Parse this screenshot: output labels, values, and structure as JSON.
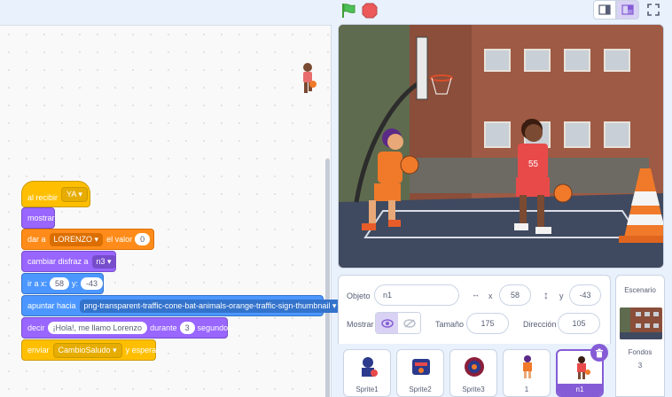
{
  "controls": {
    "green_flag": "green-flag-icon",
    "stop": "stop-icon"
  },
  "blocks": {
    "hat": {
      "prefix": "al recibir",
      "message": "YA"
    },
    "show": "mostrar",
    "set_var": {
      "prefix": "dar a",
      "variable": "LORENZO",
      "middle": "el valor",
      "value": "0"
    },
    "switch_costume": {
      "prefix": "cambiar disfraz a",
      "costume": "n3"
    },
    "goto": {
      "prefix": "ir a x:",
      "x": "58",
      "y_label": "y:",
      "y": "-43"
    },
    "point_towards": {
      "prefix": "apuntar hacia",
      "target": "png-transparent-traffic-cone-bat-animals-orange-traffic-sign-thumbnail"
    },
    "say_for": {
      "prefix": "decir",
      "message": "¡Hola!, me llamo Lorenzo",
      "middle": "durante",
      "secs": "3",
      "suffix": "segundos"
    },
    "broadcast_wait": {
      "prefix": "enviar",
      "message": "CambioSaludo",
      "suffix": "y esperar"
    }
  },
  "sprite_info": {
    "sprite_label": "Objeto",
    "sprite_name": "n1",
    "x_label": "x",
    "x": "58",
    "y_label": "y",
    "y": "-43",
    "show_label": "Mostrar",
    "size_label": "Tamaño",
    "size": "175",
    "direction_label": "Dirección",
    "direction": "105"
  },
  "sprites": [
    {
      "name": "Sprite1"
    },
    {
      "name": "Sprite2"
    },
    {
      "name": "Sprite3"
    },
    {
      "name": "1"
    },
    {
      "name": "n1",
      "selected": true
    }
  ],
  "stage_pane": {
    "title": "Escenario",
    "backdrops_label": "Fondos",
    "backdrops_count": "3"
  },
  "colors": {
    "events": "#ffbf00",
    "looks": "#9966ff",
    "data": "#ff8c1a",
    "motion": "#4c97ff",
    "accent": "#855cd6"
  }
}
